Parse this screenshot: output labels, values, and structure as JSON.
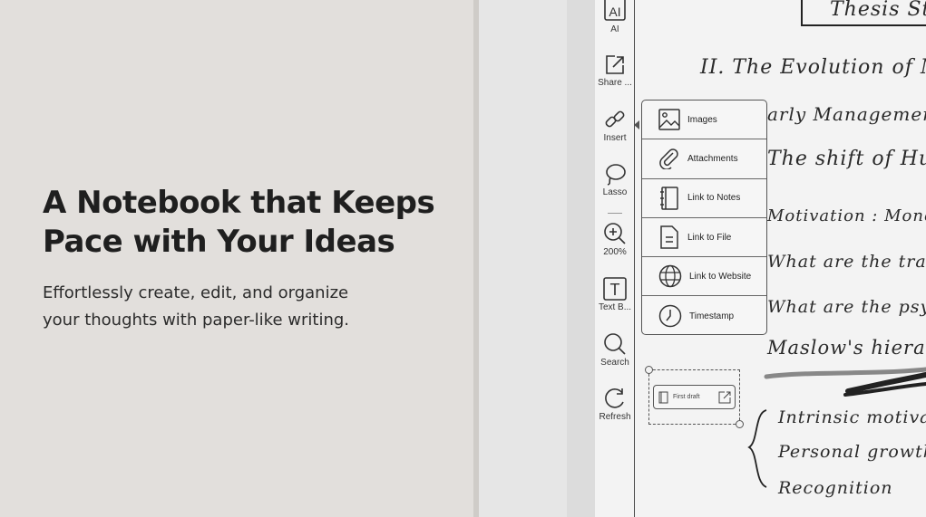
{
  "hero": {
    "headline_line1": "A Notebook that Keeps",
    "headline_line2": "Pace with Your Ideas",
    "subline_line1": "Effortlessly create, edit, and organize",
    "subline_line2": "your thoughts with paper-like writing."
  },
  "toolbar": {
    "ai": "AI",
    "share": "Share ...",
    "insert": "Insert",
    "lasso": "Lasso",
    "zoom": "200%",
    "text": "Text B...",
    "search": "Search",
    "refresh": "Refresh",
    "ai_glyph": "AI",
    "text_glyph": "T"
  },
  "insert_menu": {
    "items": [
      {
        "label": "Images",
        "icon": "image-icon"
      },
      {
        "label": "Attachments",
        "icon": "paperclip-icon"
      },
      {
        "label": "Link to Notes",
        "icon": "notebook-icon"
      },
      {
        "label": "Link to File",
        "icon": "file-icon"
      },
      {
        "label": "Link to Website",
        "icon": "globe-icon"
      },
      {
        "label": "Timestamp",
        "icon": "clock-icon"
      }
    ]
  },
  "link_card": {
    "label": "First draft"
  },
  "handwriting": {
    "thesis": "Thesis Statement",
    "line1": "II.   The Evolution of Mana",
    "line2": "arly Management",
    "line3": "The shift of Hu",
    "line4": "Motivation : Monet",
    "line5": "What are the trad",
    "line6": "What are the psych",
    "line7": "Maslow's hierarchy",
    "line8": "Intrinsic motivato",
    "line9": "Personal growth",
    "line10": "Recognition"
  },
  "colors": {
    "background": "#e2dfdc",
    "headline": "#1f1f1f",
    "screen": "#f3f3f3",
    "ink": "#2a2a2a"
  }
}
